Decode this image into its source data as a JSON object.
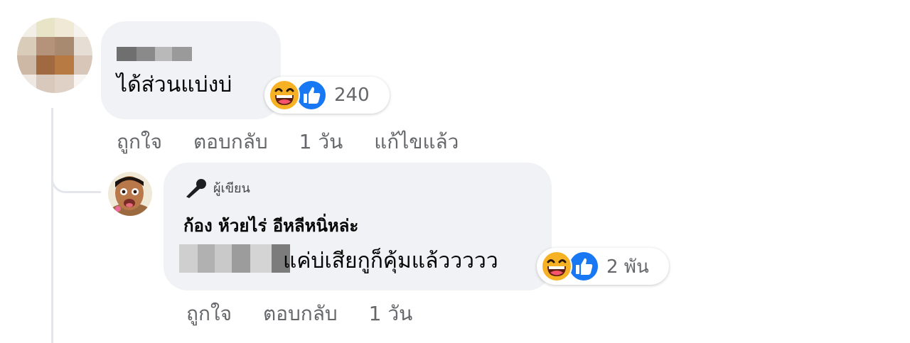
{
  "comment1": {
    "text": "ได้ส่วนแบ่งบ่",
    "reactions": {
      "emojis": [
        "haha-icon",
        "like-icon"
      ],
      "count": "240"
    },
    "actions": {
      "like": "ถูกใจ",
      "reply": "ตอบกลับ",
      "time": "1 วัน",
      "edited": "แก้ไขแล้ว"
    }
  },
  "reply1": {
    "author_badge": "ผู้เขียน",
    "author_name": "ก้อง ห้วยไร่ อีหลีหนิ่หล่ะ",
    "text": "แค่บ่เสียกูก็คุ้มแล้ววววว",
    "reactions": {
      "emojis": [
        "haha-icon",
        "like-icon"
      ],
      "count": "2 พัน"
    },
    "actions": {
      "like": "ถูกใจ",
      "reply": "ตอบกลับ",
      "time": "1 วัน"
    }
  },
  "colors": {
    "bubble": "#f0f2f5",
    "meta_text": "#65676b",
    "like_blue": "#1877f2",
    "thread_line": "#e4e6eb"
  }
}
